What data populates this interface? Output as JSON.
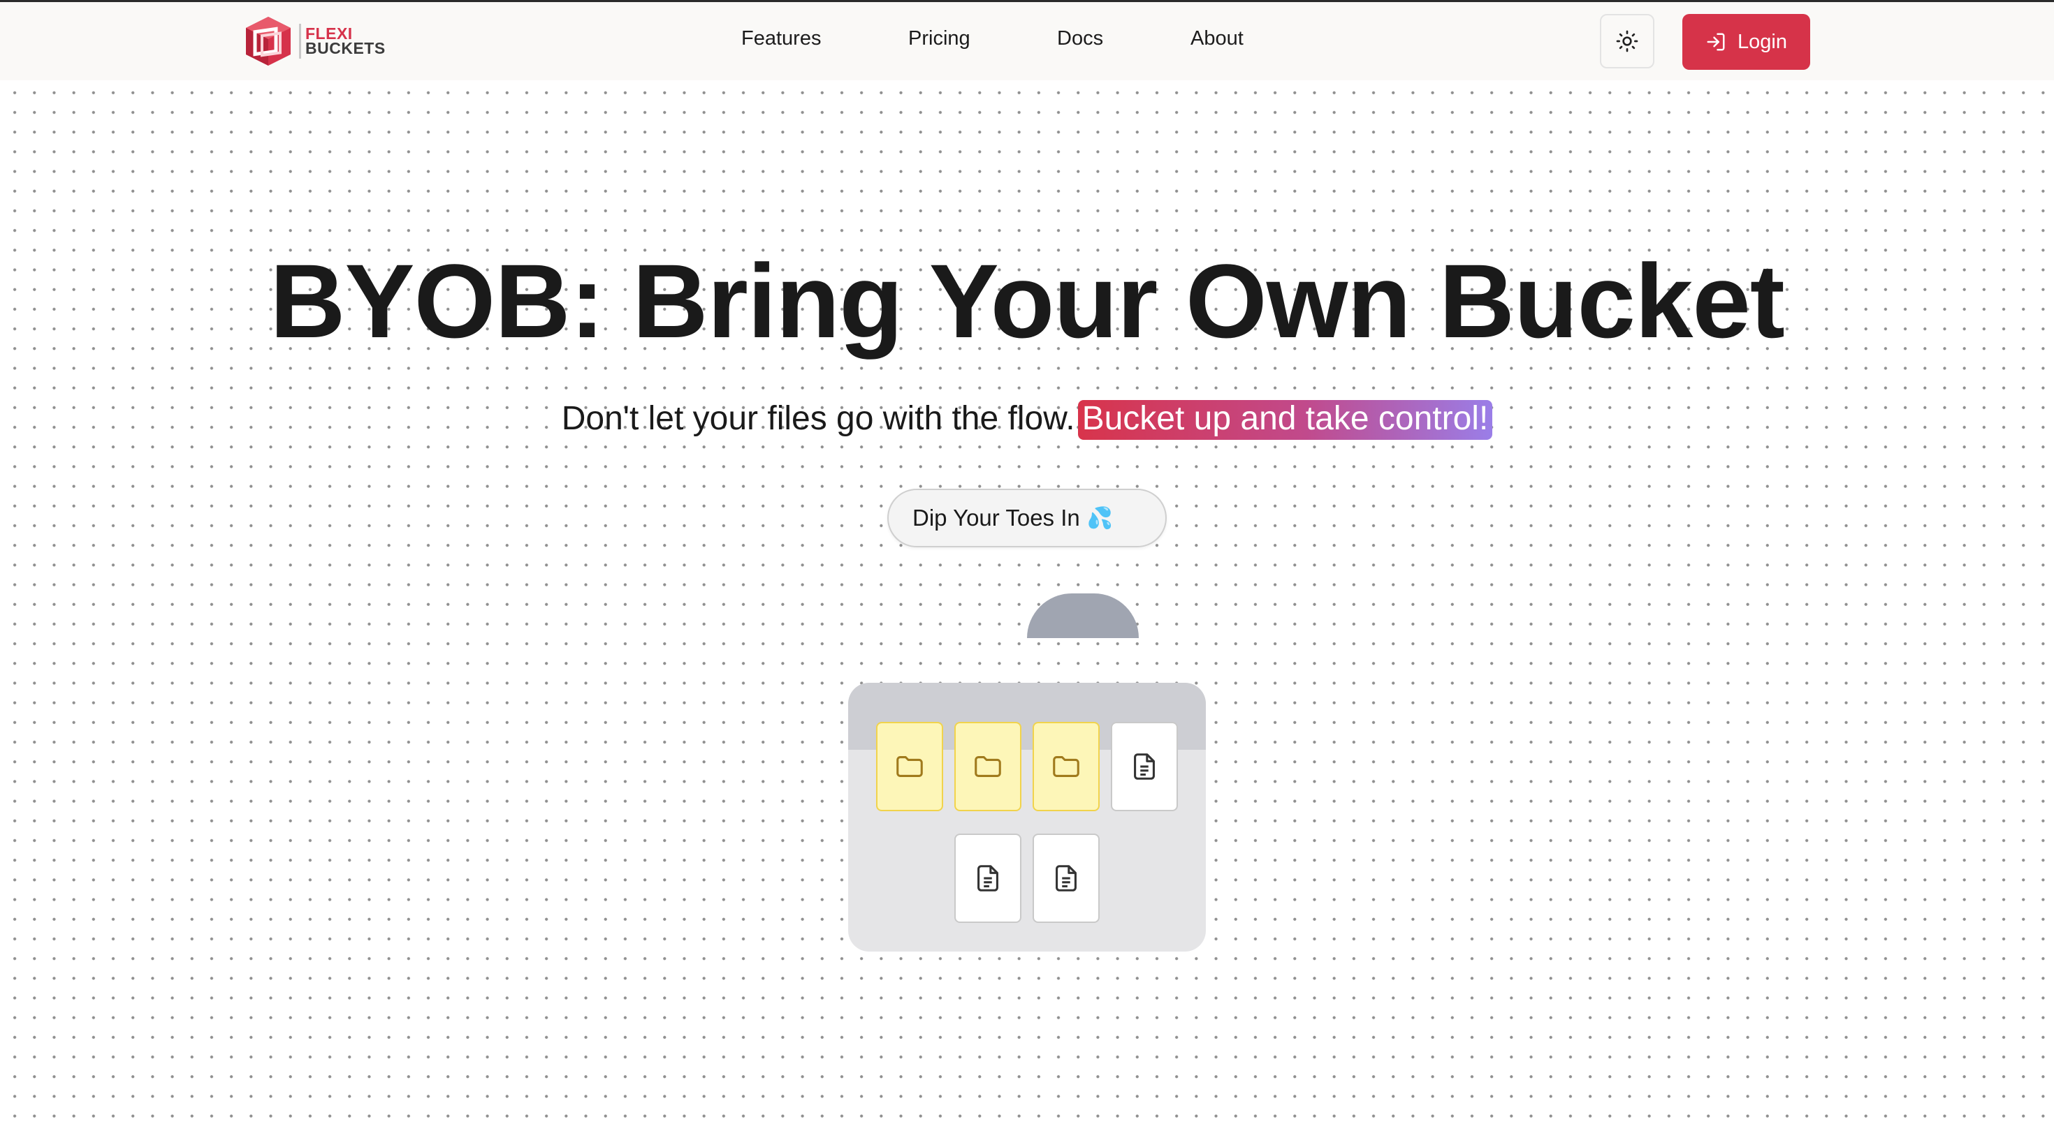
{
  "brand": {
    "line1": "FLEXI",
    "line2": "BUCKETS",
    "color": "#d6324a"
  },
  "nav": {
    "links": [
      "Features",
      "Pricing",
      "Docs",
      "About"
    ],
    "theme_toggle_icon": "sun-icon",
    "login_label": "Login",
    "login_icon": "login-arrow-icon",
    "accent": "#d63349"
  },
  "hero": {
    "title": "BYOB: Bring Your Own Bucket",
    "subtitle_plain": "Don't let your files go with the flow.",
    "subtitle_highlight": "Bucket up and take control!",
    "cta_label": "Dip Your Toes In",
    "cta_emoji": "💦"
  },
  "bucket": {
    "items": [
      {
        "type": "folder",
        "icon": "folder-icon"
      },
      {
        "type": "folder",
        "icon": "folder-icon"
      },
      {
        "type": "folder",
        "icon": "folder-icon"
      },
      {
        "type": "file",
        "icon": "file-text-icon"
      },
      {
        "type": "file",
        "icon": "file-text-icon"
      },
      {
        "type": "file",
        "icon": "file-text-icon"
      }
    ]
  }
}
